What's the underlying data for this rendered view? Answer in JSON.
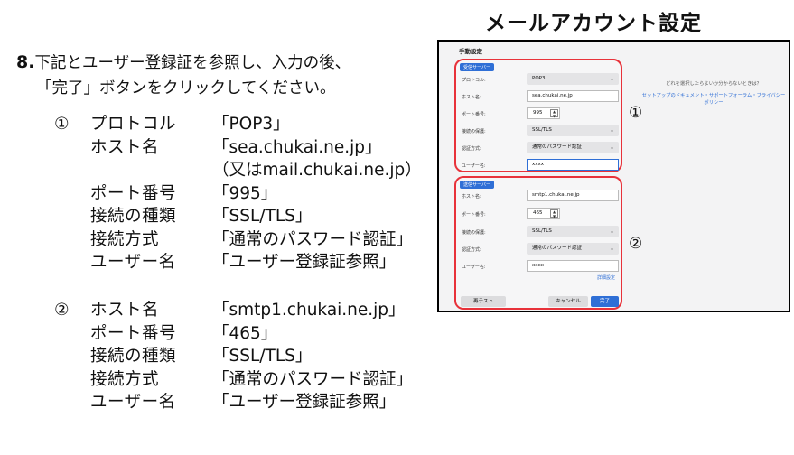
{
  "instruction": {
    "number": "8.",
    "line1": "下記とユーザー登録証を参照し、入力の後、",
    "line2": "「完了」ボタンをクリックしてください。"
  },
  "block1": {
    "mark": "①",
    "rows": [
      {
        "label": "プロトコル",
        "value": "「POP3」"
      },
      {
        "label": "ホスト名",
        "value": "「sea.chukai.ne.jp」"
      },
      {
        "label": "",
        "value": "（又はmail.chukai.ne.jp）"
      },
      {
        "label": "ポート番号",
        "value": "「995」"
      },
      {
        "label": "接続の種類",
        "value": "「SSL/TLS」"
      },
      {
        "label": "接続方式",
        "value": "「通常のパスワード認証」"
      },
      {
        "label": "ユーザー名",
        "value": "「ユーザー登録証参照」"
      }
    ]
  },
  "block2": {
    "mark": "②",
    "rows": [
      {
        "label": "ホスト名",
        "value": "「smtp1.chukai.ne.jp」"
      },
      {
        "label": "ポート番号",
        "value": "「465」"
      },
      {
        "label": "接続の種類",
        "value": "「SSL/TLS」"
      },
      {
        "label": "接続方式",
        "value": "「通常のパスワード認証」"
      },
      {
        "label": "ユーザー名",
        "value": "「ユーザー登録証参照」"
      }
    ]
  },
  "heading": "メールアカウント設定",
  "dialog": {
    "title": "手動設定",
    "incoming": {
      "tag": "受信サーバー",
      "protocol_label": "プロトコル:",
      "protocol_value": "POP3",
      "host_label": "ホスト名:",
      "host_value": "sea.chukai.ne.jp",
      "port_label": "ポート番号:",
      "port_value": "995",
      "security_label": "接続の保護:",
      "security_value": "SSL/TLS",
      "auth_label": "認証方式:",
      "auth_value": "通常のパスワード認証",
      "user_label": "ユーザー名:",
      "user_value": "xxxx"
    },
    "outgoing": {
      "tag": "送信サーバー",
      "host_label": "ホスト名:",
      "host_value": "smtp1.chukai.ne.jp",
      "port_label": "ポート番号:",
      "port_value": "465",
      "security_label": "接続の保護:",
      "security_value": "SSL/TLS",
      "auth_label": "認証方式:",
      "auth_value": "通常のパスワード認証",
      "user_label": "ユーザー名:",
      "user_value": "xxxx",
      "advanced_label": "詳細設定"
    },
    "buttons": {
      "retest": "再テスト",
      "cancel": "キャンセル",
      "done": "完了"
    },
    "help": {
      "question": "どれを選択したらよいか分からないときは？",
      "links": "セットアップのドキュメント・サポートフォーラム・プライバシーポリシー"
    }
  },
  "callout1": "①",
  "callout2": "②",
  "colors": {
    "highlight": "#e8323a",
    "accent": "#2f6fd6"
  }
}
